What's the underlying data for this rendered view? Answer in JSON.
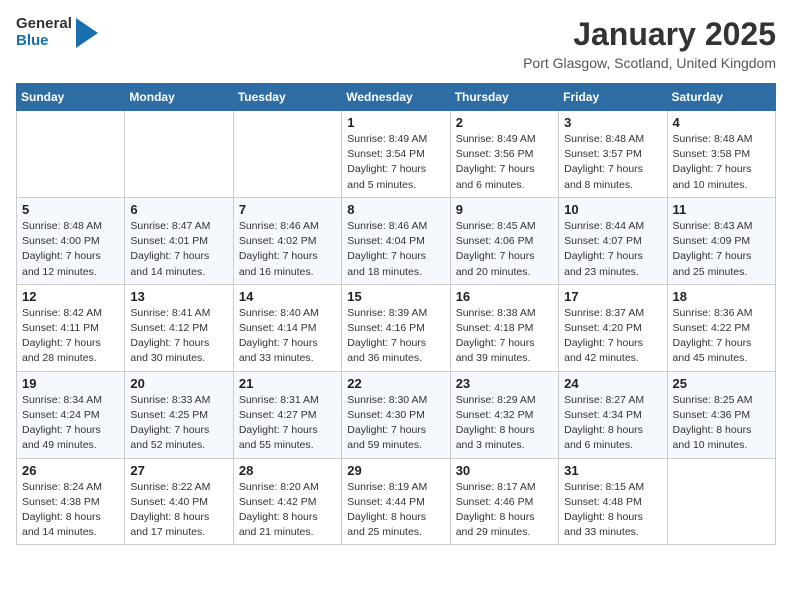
{
  "logo": {
    "general": "General",
    "blue": "Blue"
  },
  "title": "January 2025",
  "location": "Port Glasgow, Scotland, United Kingdom",
  "weekdays": [
    "Sunday",
    "Monday",
    "Tuesday",
    "Wednesday",
    "Thursday",
    "Friday",
    "Saturday"
  ],
  "weeks": [
    [
      {
        "day": "",
        "info": ""
      },
      {
        "day": "",
        "info": ""
      },
      {
        "day": "",
        "info": ""
      },
      {
        "day": "1",
        "info": "Sunrise: 8:49 AM\nSunset: 3:54 PM\nDaylight: 7 hours and 5 minutes."
      },
      {
        "day": "2",
        "info": "Sunrise: 8:49 AM\nSunset: 3:56 PM\nDaylight: 7 hours and 6 minutes."
      },
      {
        "day": "3",
        "info": "Sunrise: 8:48 AM\nSunset: 3:57 PM\nDaylight: 7 hours and 8 minutes."
      },
      {
        "day": "4",
        "info": "Sunrise: 8:48 AM\nSunset: 3:58 PM\nDaylight: 7 hours and 10 minutes."
      }
    ],
    [
      {
        "day": "5",
        "info": "Sunrise: 8:48 AM\nSunset: 4:00 PM\nDaylight: 7 hours and 12 minutes."
      },
      {
        "day": "6",
        "info": "Sunrise: 8:47 AM\nSunset: 4:01 PM\nDaylight: 7 hours and 14 minutes."
      },
      {
        "day": "7",
        "info": "Sunrise: 8:46 AM\nSunset: 4:02 PM\nDaylight: 7 hours and 16 minutes."
      },
      {
        "day": "8",
        "info": "Sunrise: 8:46 AM\nSunset: 4:04 PM\nDaylight: 7 hours and 18 minutes."
      },
      {
        "day": "9",
        "info": "Sunrise: 8:45 AM\nSunset: 4:06 PM\nDaylight: 7 hours and 20 minutes."
      },
      {
        "day": "10",
        "info": "Sunrise: 8:44 AM\nSunset: 4:07 PM\nDaylight: 7 hours and 23 minutes."
      },
      {
        "day": "11",
        "info": "Sunrise: 8:43 AM\nSunset: 4:09 PM\nDaylight: 7 hours and 25 minutes."
      }
    ],
    [
      {
        "day": "12",
        "info": "Sunrise: 8:42 AM\nSunset: 4:11 PM\nDaylight: 7 hours and 28 minutes."
      },
      {
        "day": "13",
        "info": "Sunrise: 8:41 AM\nSunset: 4:12 PM\nDaylight: 7 hours and 30 minutes."
      },
      {
        "day": "14",
        "info": "Sunrise: 8:40 AM\nSunset: 4:14 PM\nDaylight: 7 hours and 33 minutes."
      },
      {
        "day": "15",
        "info": "Sunrise: 8:39 AM\nSunset: 4:16 PM\nDaylight: 7 hours and 36 minutes."
      },
      {
        "day": "16",
        "info": "Sunrise: 8:38 AM\nSunset: 4:18 PM\nDaylight: 7 hours and 39 minutes."
      },
      {
        "day": "17",
        "info": "Sunrise: 8:37 AM\nSunset: 4:20 PM\nDaylight: 7 hours and 42 minutes."
      },
      {
        "day": "18",
        "info": "Sunrise: 8:36 AM\nSunset: 4:22 PM\nDaylight: 7 hours and 45 minutes."
      }
    ],
    [
      {
        "day": "19",
        "info": "Sunrise: 8:34 AM\nSunset: 4:24 PM\nDaylight: 7 hours and 49 minutes."
      },
      {
        "day": "20",
        "info": "Sunrise: 8:33 AM\nSunset: 4:25 PM\nDaylight: 7 hours and 52 minutes."
      },
      {
        "day": "21",
        "info": "Sunrise: 8:31 AM\nSunset: 4:27 PM\nDaylight: 7 hours and 55 minutes."
      },
      {
        "day": "22",
        "info": "Sunrise: 8:30 AM\nSunset: 4:30 PM\nDaylight: 7 hours and 59 minutes."
      },
      {
        "day": "23",
        "info": "Sunrise: 8:29 AM\nSunset: 4:32 PM\nDaylight: 8 hours and 3 minutes."
      },
      {
        "day": "24",
        "info": "Sunrise: 8:27 AM\nSunset: 4:34 PM\nDaylight: 8 hours and 6 minutes."
      },
      {
        "day": "25",
        "info": "Sunrise: 8:25 AM\nSunset: 4:36 PM\nDaylight: 8 hours and 10 minutes."
      }
    ],
    [
      {
        "day": "26",
        "info": "Sunrise: 8:24 AM\nSunset: 4:38 PM\nDaylight: 8 hours and 14 minutes."
      },
      {
        "day": "27",
        "info": "Sunrise: 8:22 AM\nSunset: 4:40 PM\nDaylight: 8 hours and 17 minutes."
      },
      {
        "day": "28",
        "info": "Sunrise: 8:20 AM\nSunset: 4:42 PM\nDaylight: 8 hours and 21 minutes."
      },
      {
        "day": "29",
        "info": "Sunrise: 8:19 AM\nSunset: 4:44 PM\nDaylight: 8 hours and 25 minutes."
      },
      {
        "day": "30",
        "info": "Sunrise: 8:17 AM\nSunset: 4:46 PM\nDaylight: 8 hours and 29 minutes."
      },
      {
        "day": "31",
        "info": "Sunrise: 8:15 AM\nSunset: 4:48 PM\nDaylight: 8 hours and 33 minutes."
      },
      {
        "day": "",
        "info": ""
      }
    ]
  ]
}
